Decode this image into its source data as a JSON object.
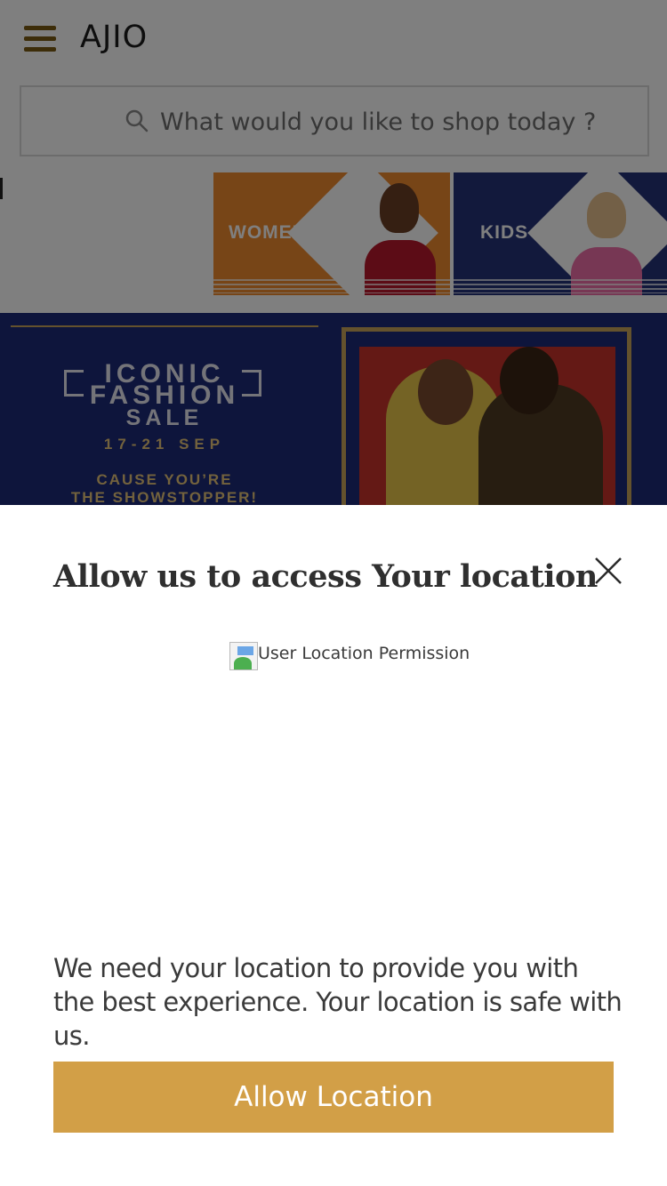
{
  "header": {
    "menu_icon": "hamburger-icon",
    "logo": "AJIO"
  },
  "search": {
    "icon": "search-icon",
    "placeholder": "What would you like to shop today ?"
  },
  "category_tiles": [
    {
      "label": "WOMEN",
      "color": "#ef8a2e"
    },
    {
      "label": "KIDS",
      "color": "#253279"
    }
  ],
  "banner": {
    "line1": "ICONIC",
    "line2": "FASHION",
    "line3": "SALE",
    "dates": "17-21 SEP",
    "tagline1": "CAUSE YOU’RE",
    "tagline2": "THE SHOWSTOPPER!",
    "color": "#1c2a78",
    "accent": "#c9a45a"
  },
  "location_sheet": {
    "title": "Allow us to access Your location",
    "close_icon": "close-icon",
    "image_alt": "User Location Permission",
    "message": "We need your location to provide you with the best experience. Your location is safe with us.",
    "button_label": "Allow Location",
    "button_color": "#d29f47"
  }
}
